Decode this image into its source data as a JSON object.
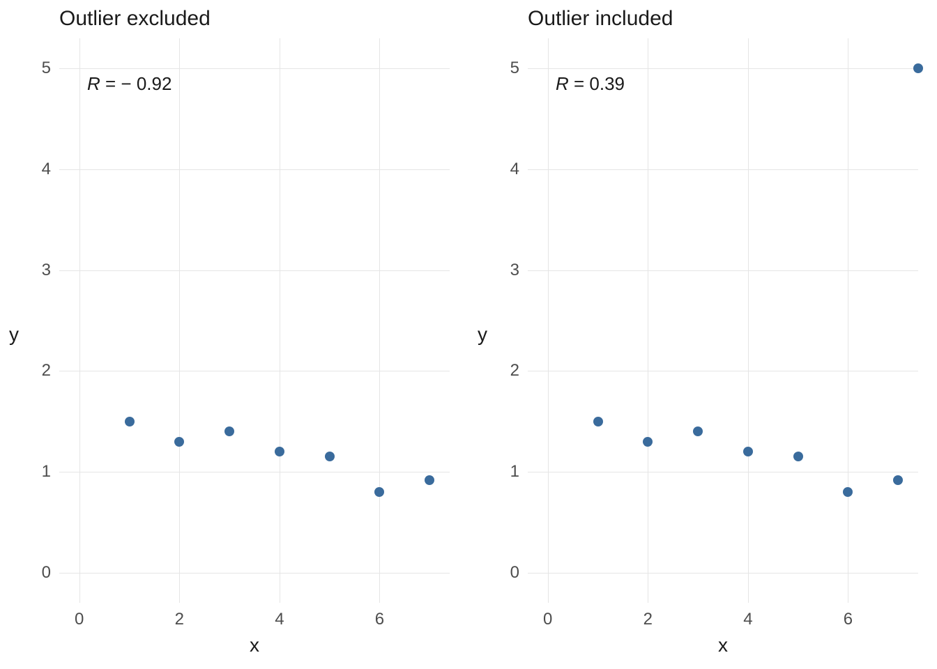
{
  "chart_data": [
    {
      "type": "scatter",
      "title": "Outlier excluded",
      "xlabel": "x",
      "ylabel": "y",
      "xlim": [
        -0.4,
        7.4
      ],
      "ylim": [
        -0.3,
        5.3
      ],
      "xticks": [
        0,
        2,
        4,
        6
      ],
      "yticks": [
        0,
        1,
        2,
        3,
        4,
        5
      ],
      "annotation": {
        "prefix": "R",
        "value": " = − 0.92"
      },
      "points": [
        {
          "x": 1,
          "y": 1.5
        },
        {
          "x": 2,
          "y": 1.3
        },
        {
          "x": 3,
          "y": 1.4
        },
        {
          "x": 4,
          "y": 1.2
        },
        {
          "x": 5,
          "y": 1.15
        },
        {
          "x": 6,
          "y": 0.8
        },
        {
          "x": 7,
          "y": 0.92
        }
      ]
    },
    {
      "type": "scatter",
      "title": "Outlier included",
      "xlabel": "x",
      "ylabel": "y",
      "xlim": [
        -0.4,
        7.4
      ],
      "ylim": [
        -0.3,
        5.3
      ],
      "xticks": [
        0,
        2,
        4,
        6
      ],
      "yticks": [
        0,
        1,
        2,
        3,
        4,
        5
      ],
      "annotation": {
        "prefix": "R",
        "value": " = 0.39"
      },
      "points": [
        {
          "x": 1,
          "y": 1.5
        },
        {
          "x": 2,
          "y": 1.3
        },
        {
          "x": 3,
          "y": 1.4
        },
        {
          "x": 4,
          "y": 1.2
        },
        {
          "x": 5,
          "y": 1.15
        },
        {
          "x": 6,
          "y": 0.8
        },
        {
          "x": 7,
          "y": 0.92
        },
        {
          "x": 7.4,
          "y": 5.0
        }
      ]
    }
  ]
}
